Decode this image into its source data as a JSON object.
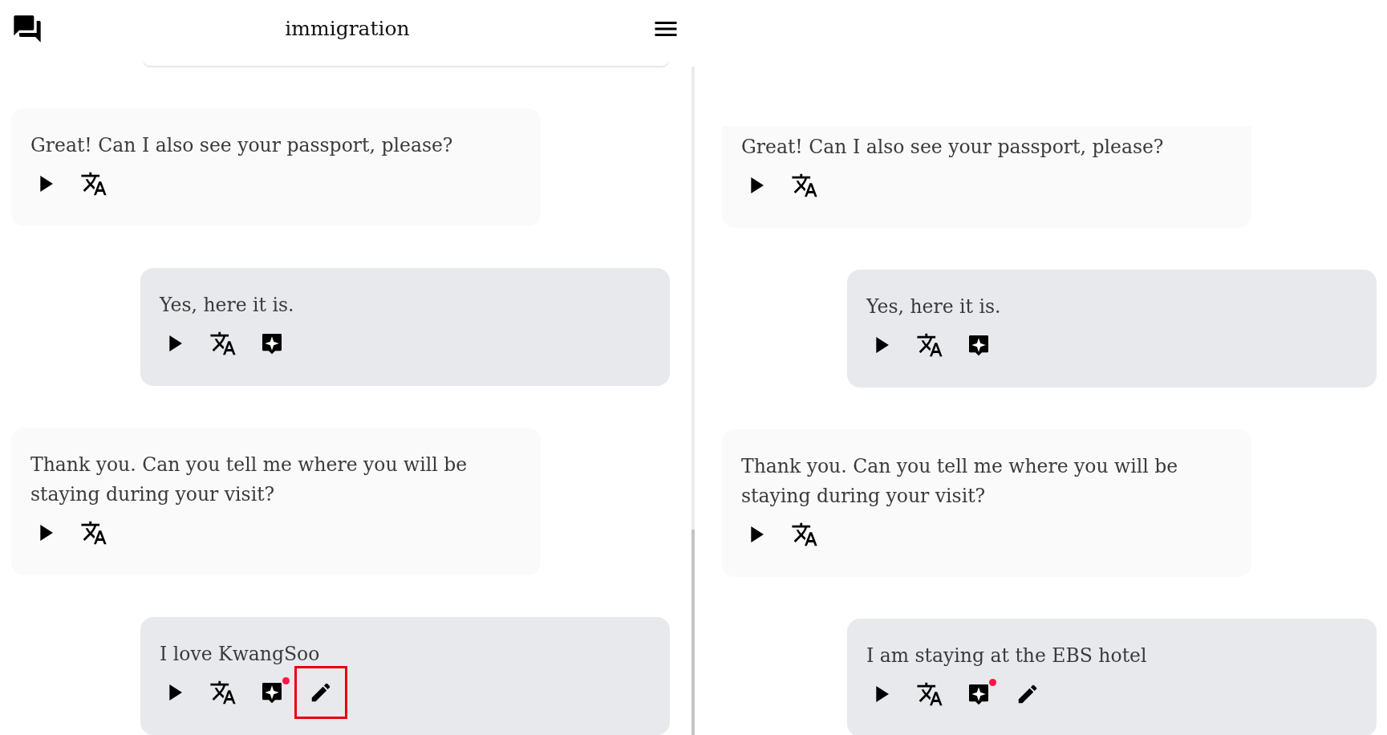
{
  "panels": [
    {
      "header": {
        "title": "immigration"
      },
      "messages": [
        {
          "kind": "partial",
          "clipped": true
        },
        {
          "kind": "bot",
          "clipped": false,
          "text": "Great! Can I also see your passport, please?",
          "actions": [
            {
              "kind": "play"
            },
            {
              "kind": "translate"
            }
          ]
        },
        {
          "kind": "user",
          "clipped": false,
          "text": "Yes, here it is.",
          "actions": [
            {
              "kind": "play"
            },
            {
              "kind": "translate"
            },
            {
              "kind": "hint",
              "badge": false
            }
          ]
        },
        {
          "kind": "bot",
          "clipped": false,
          "text": "Thank you. Can you tell me where you will be staying during your visit?",
          "actions": [
            {
              "kind": "play"
            },
            {
              "kind": "translate"
            }
          ]
        },
        {
          "kind": "user",
          "clipped": false,
          "text": "I love KwangSoo",
          "actions": [
            {
              "kind": "play"
            },
            {
              "kind": "translate"
            },
            {
              "kind": "hint",
              "badge": true
            },
            {
              "kind": "edit",
              "highlighted": true
            }
          ]
        }
      ]
    },
    {
      "messages": [
        {
          "kind": "bot",
          "clipped": true,
          "text": "Great! Can I also see your passport, please?",
          "actions": [
            {
              "kind": "play"
            },
            {
              "kind": "translate"
            }
          ]
        },
        {
          "kind": "user",
          "clipped": false,
          "text": "Yes, here it is.",
          "actions": [
            {
              "kind": "play"
            },
            {
              "kind": "translate"
            },
            {
              "kind": "hint",
              "badge": false
            }
          ]
        },
        {
          "kind": "bot",
          "clipped": false,
          "text": "Thank you. Can you tell me where you will be staying during your visit?",
          "actions": [
            {
              "kind": "play"
            },
            {
              "kind": "translate"
            }
          ]
        },
        {
          "kind": "user",
          "clipped": false,
          "text": "I am staying at the EBS hotel",
          "actions": [
            {
              "kind": "play"
            },
            {
              "kind": "translate"
            },
            {
              "kind": "hint",
              "badge": true
            },
            {
              "kind": "edit",
              "highlighted": false
            }
          ]
        }
      ]
    }
  ]
}
